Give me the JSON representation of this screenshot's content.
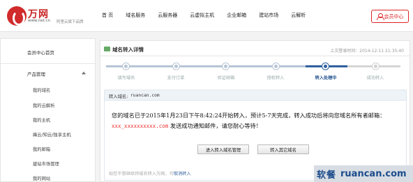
{
  "brand": {
    "name": "万网",
    "url": "www.net.cn",
    "slogan": "阿里云旗下品牌",
    "color": "#c82424"
  },
  "nav": [
    "首 页",
    "域名服务",
    "云服务器",
    "云虚拟主机",
    "企业邮箱",
    "建站市场",
    "云解析"
  ],
  "member_center": "会员中心",
  "sidebar": {
    "home": "会员中心首页",
    "group": "产品管理",
    "items": [
      "我的域名",
      "我的云解析",
      "我的主机",
      "峰云/知云/独享主机",
      "我的邮箱",
      "建站市场管理",
      "我的网站"
    ]
  },
  "main": {
    "title": "域名转入详情",
    "last_login": "上次登录时间：2014-12-11 21:35:40",
    "steps": [
      {
        "label": "填写域名",
        "state": "done"
      },
      {
        "label": "支付订单",
        "state": "done"
      },
      {
        "label": "验证邮箱",
        "state": "done"
      },
      {
        "label": "授权转入",
        "state": "done"
      },
      {
        "label": "转入处理中",
        "state": "current"
      },
      {
        "label": "成功转入",
        "state": "todo"
      }
    ],
    "domain_label": "转入域名:",
    "domain_value": "ruancan.com",
    "notice_part1": "您的域名已于2015年1月23日下午8:42:24开始转入，预计5-7天完成，转入成功后将向您域名所有者邮箱：",
    "notice_email": "xxx_xxxxxxxxxx.com",
    "notice_part2": " 发送成功通知邮件，请您耐心等待！",
    "btn_manage": "进入转入域名管理",
    "btn_other": "转入其它域名",
    "footer_text": "如您不想继续将域名转入万网，可",
    "footer_link": "取消转入"
  },
  "watermark": {
    "han": "软餐",
    "url": "ruancan.com"
  }
}
